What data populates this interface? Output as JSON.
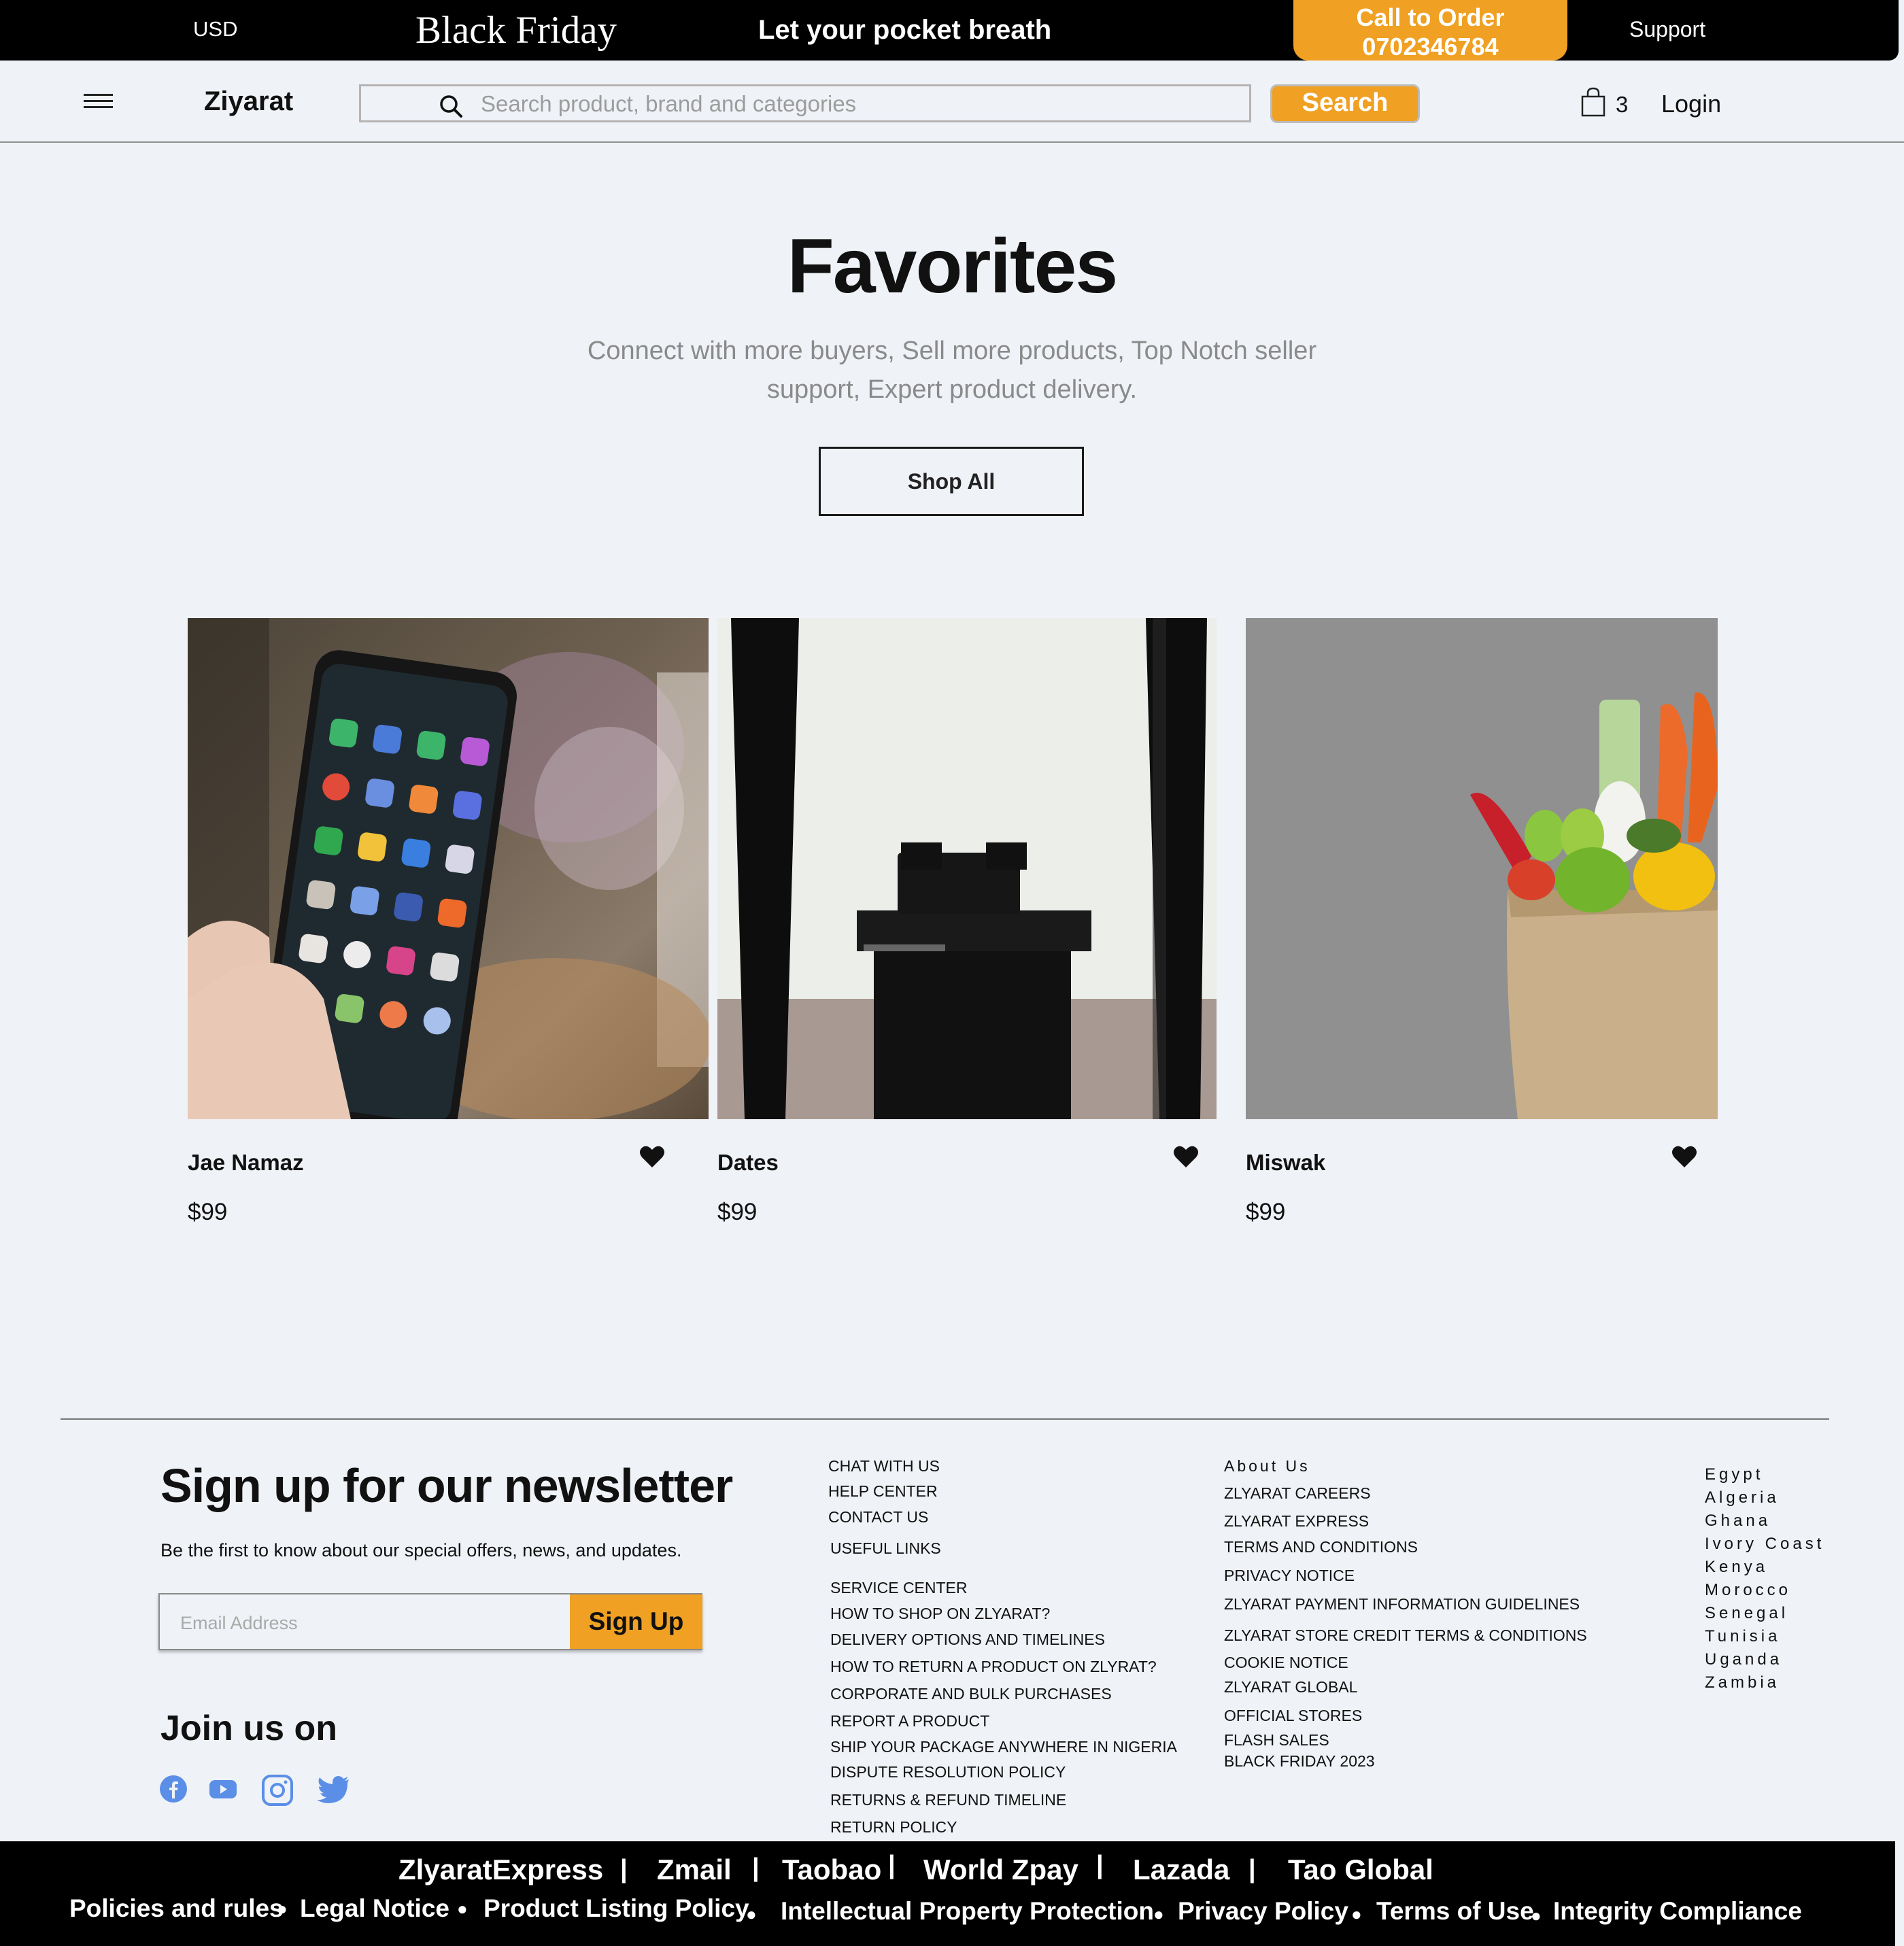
{
  "topbar": {
    "currency": "USD",
    "promo": "Black Friday",
    "slogan": "Let your pocket breath",
    "call_label": "Call to Order",
    "call_number": "0702346784",
    "support": "Support"
  },
  "header": {
    "logo": "Ziyarat",
    "search_placeholder": "Search product, brand and categories",
    "search_button": "Search",
    "cart_count": "3",
    "login": "Login"
  },
  "hero": {
    "title": "Favorites",
    "subtitle": "Connect with more buyers, Sell more products, Top Notch seller support, Expert product delivery.",
    "cta": "Shop All"
  },
  "products": [
    {
      "name": "Jae Namaz",
      "price": "$99"
    },
    {
      "name": "Dates",
      "price": "$99"
    },
    {
      "name": "Miswak",
      "price": "$99"
    }
  ],
  "newsletter": {
    "title": "Sign up for our newsletter",
    "subtitle": "Be the first to know about our special offers, news, and updates.",
    "email_placeholder": "Email Address",
    "button": "Sign Up",
    "join": "Join us on"
  },
  "footer": {
    "col1": [
      "CHAT WITH US",
      "HELP CENTER",
      "CONTACT US",
      "USEFUL LINKS",
      "SERVICE CENTER",
      "HOW TO SHOP ON  ZLYARAT?",
      "DELIVERY OPTIONS AND TIMELINES",
      "HOW TO RETURN A PRODUCT ON ZLYRAT?",
      "CORPORATE AND BULK PURCHASES",
      "REPORT A PRODUCT",
      "SHIP YOUR PACKAGE ANYWHERE IN NIGERIA",
      "DISPUTE RESOLUTION POLICY",
      "RETURNS & REFUND TIMELINE",
      "RETURN POLICY"
    ],
    "col2": [
      "About Us",
      "ZLYARAT CAREERS",
      "ZLYARAT EXPRESS",
      "TERMS AND CONDITIONS",
      "PRIVACY NOTICE",
      "ZLYARAT PAYMENT INFORMATION GUIDELINES",
      "ZLYARAT STORE CREDIT TERMS & CONDITIONS",
      "COOKIE NOTICE",
      "ZLYARAT GLOBAL",
      "OFFICIAL STORES",
      "FLASH SALES",
      "BLACK FRIDAY 2023"
    ],
    "countries": [
      "Egypt",
      "Algeria",
      "Ghana",
      "Ivory Coast",
      "Kenya",
      "Morocco",
      "Senegal",
      "Tunisia",
      "Uganda",
      "Zambia"
    ]
  },
  "bottombar": {
    "brands": [
      "ZlyaratExpress",
      "Zmail",
      "Taobao",
      "World Zpay",
      "Lazada",
      "Tao Global"
    ],
    "policies": [
      "Policies and rules",
      "Legal Notice",
      "Product Listing Policy",
      "Intellectual Property Protection",
      "Privacy Policy",
      "Terms of Use",
      "Integrity Compliance"
    ]
  },
  "colors": {
    "accent": "#f0a022",
    "background": "#eff2f7",
    "bar": "#000000"
  }
}
